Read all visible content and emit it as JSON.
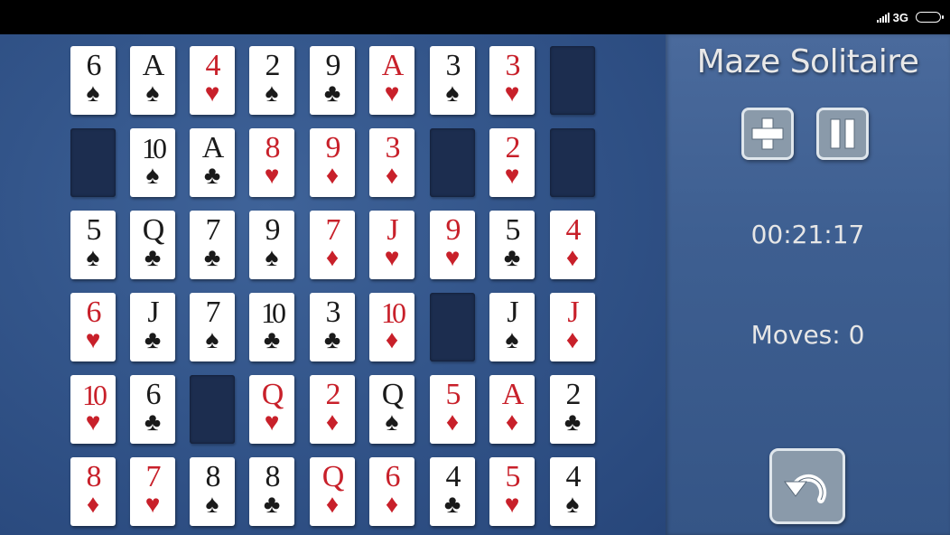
{
  "status_bar": {
    "network": "3G"
  },
  "game": {
    "title": "Maze Solitaire",
    "timer": "00:21:17",
    "moves": "Moves: 0",
    "buttons": {
      "new_game": "plus-icon",
      "pause": "pause-icon",
      "undo": "undo-icon"
    }
  },
  "colors": {
    "red_suit": "#c8202a",
    "black_suit": "#1a1a1a",
    "table": "#33558a",
    "empty_slot": "#1c2d4f",
    "button": "#8a9aaa"
  },
  "board": {
    "rows": [
      [
        {
          "rank": "6",
          "suit": "♠",
          "color": "black"
        },
        {
          "rank": "A",
          "suit": "♠",
          "color": "black"
        },
        {
          "rank": "4",
          "suit": "♥",
          "color": "red"
        },
        {
          "rank": "2",
          "suit": "♠",
          "color": "black"
        },
        {
          "rank": "9",
          "suit": "♣",
          "color": "black"
        },
        {
          "rank": "A",
          "suit": "♥",
          "color": "red"
        },
        {
          "rank": "3",
          "suit": "♠",
          "color": "black"
        },
        {
          "rank": "3",
          "suit": "♥",
          "color": "red"
        },
        null
      ],
      [
        null,
        {
          "rank": "10",
          "suit": "♠",
          "color": "black"
        },
        {
          "rank": "A",
          "suit": "♣",
          "color": "black"
        },
        {
          "rank": "8",
          "suit": "♥",
          "color": "red"
        },
        {
          "rank": "9",
          "suit": "♦",
          "color": "red"
        },
        {
          "rank": "3",
          "suit": "♦",
          "color": "red"
        },
        null,
        {
          "rank": "2",
          "suit": "♥",
          "color": "red"
        },
        null
      ],
      [
        {
          "rank": "5",
          "suit": "♠",
          "color": "black"
        },
        {
          "rank": "Q",
          "suit": "♣",
          "color": "black"
        },
        {
          "rank": "7",
          "suit": "♣",
          "color": "black"
        },
        {
          "rank": "9",
          "suit": "♠",
          "color": "black"
        },
        {
          "rank": "7",
          "suit": "♦",
          "color": "red"
        },
        {
          "rank": "J",
          "suit": "♥",
          "color": "red"
        },
        {
          "rank": "9",
          "suit": "♥",
          "color": "red"
        },
        {
          "rank": "5",
          "suit": "♣",
          "color": "black"
        },
        {
          "rank": "4",
          "suit": "♦",
          "color": "red"
        }
      ],
      [
        {
          "rank": "6",
          "suit": "♥",
          "color": "red"
        },
        {
          "rank": "J",
          "suit": "♣",
          "color": "black"
        },
        {
          "rank": "7",
          "suit": "♠",
          "color": "black"
        },
        {
          "rank": "10",
          "suit": "♣",
          "color": "black"
        },
        {
          "rank": "3",
          "suit": "♣",
          "color": "black"
        },
        {
          "rank": "10",
          "suit": "♦",
          "color": "red"
        },
        null,
        {
          "rank": "J",
          "suit": "♠",
          "color": "black"
        },
        {
          "rank": "J",
          "suit": "♦",
          "color": "red"
        }
      ],
      [
        {
          "rank": "10",
          "suit": "♥",
          "color": "red"
        },
        {
          "rank": "6",
          "suit": "♣",
          "color": "black"
        },
        null,
        {
          "rank": "Q",
          "suit": "♥",
          "color": "red"
        },
        {
          "rank": "2",
          "suit": "♦",
          "color": "red"
        },
        {
          "rank": "Q",
          "suit": "♠",
          "color": "black"
        },
        {
          "rank": "5",
          "suit": "♦",
          "color": "red"
        },
        {
          "rank": "A",
          "suit": "♦",
          "color": "red"
        },
        {
          "rank": "2",
          "suit": "♣",
          "color": "black"
        }
      ],
      [
        {
          "rank": "8",
          "suit": "♦",
          "color": "red"
        },
        {
          "rank": "7",
          "suit": "♥",
          "color": "red"
        },
        {
          "rank": "8",
          "suit": "♠",
          "color": "black"
        },
        {
          "rank": "8",
          "suit": "♣",
          "color": "black"
        },
        {
          "rank": "Q",
          "suit": "♦",
          "color": "red"
        },
        {
          "rank": "6",
          "suit": "♦",
          "color": "red"
        },
        {
          "rank": "4",
          "suit": "♣",
          "color": "black"
        },
        {
          "rank": "5",
          "suit": "♥",
          "color": "red"
        },
        {
          "rank": "4",
          "suit": "♠",
          "color": "black"
        }
      ]
    ]
  }
}
